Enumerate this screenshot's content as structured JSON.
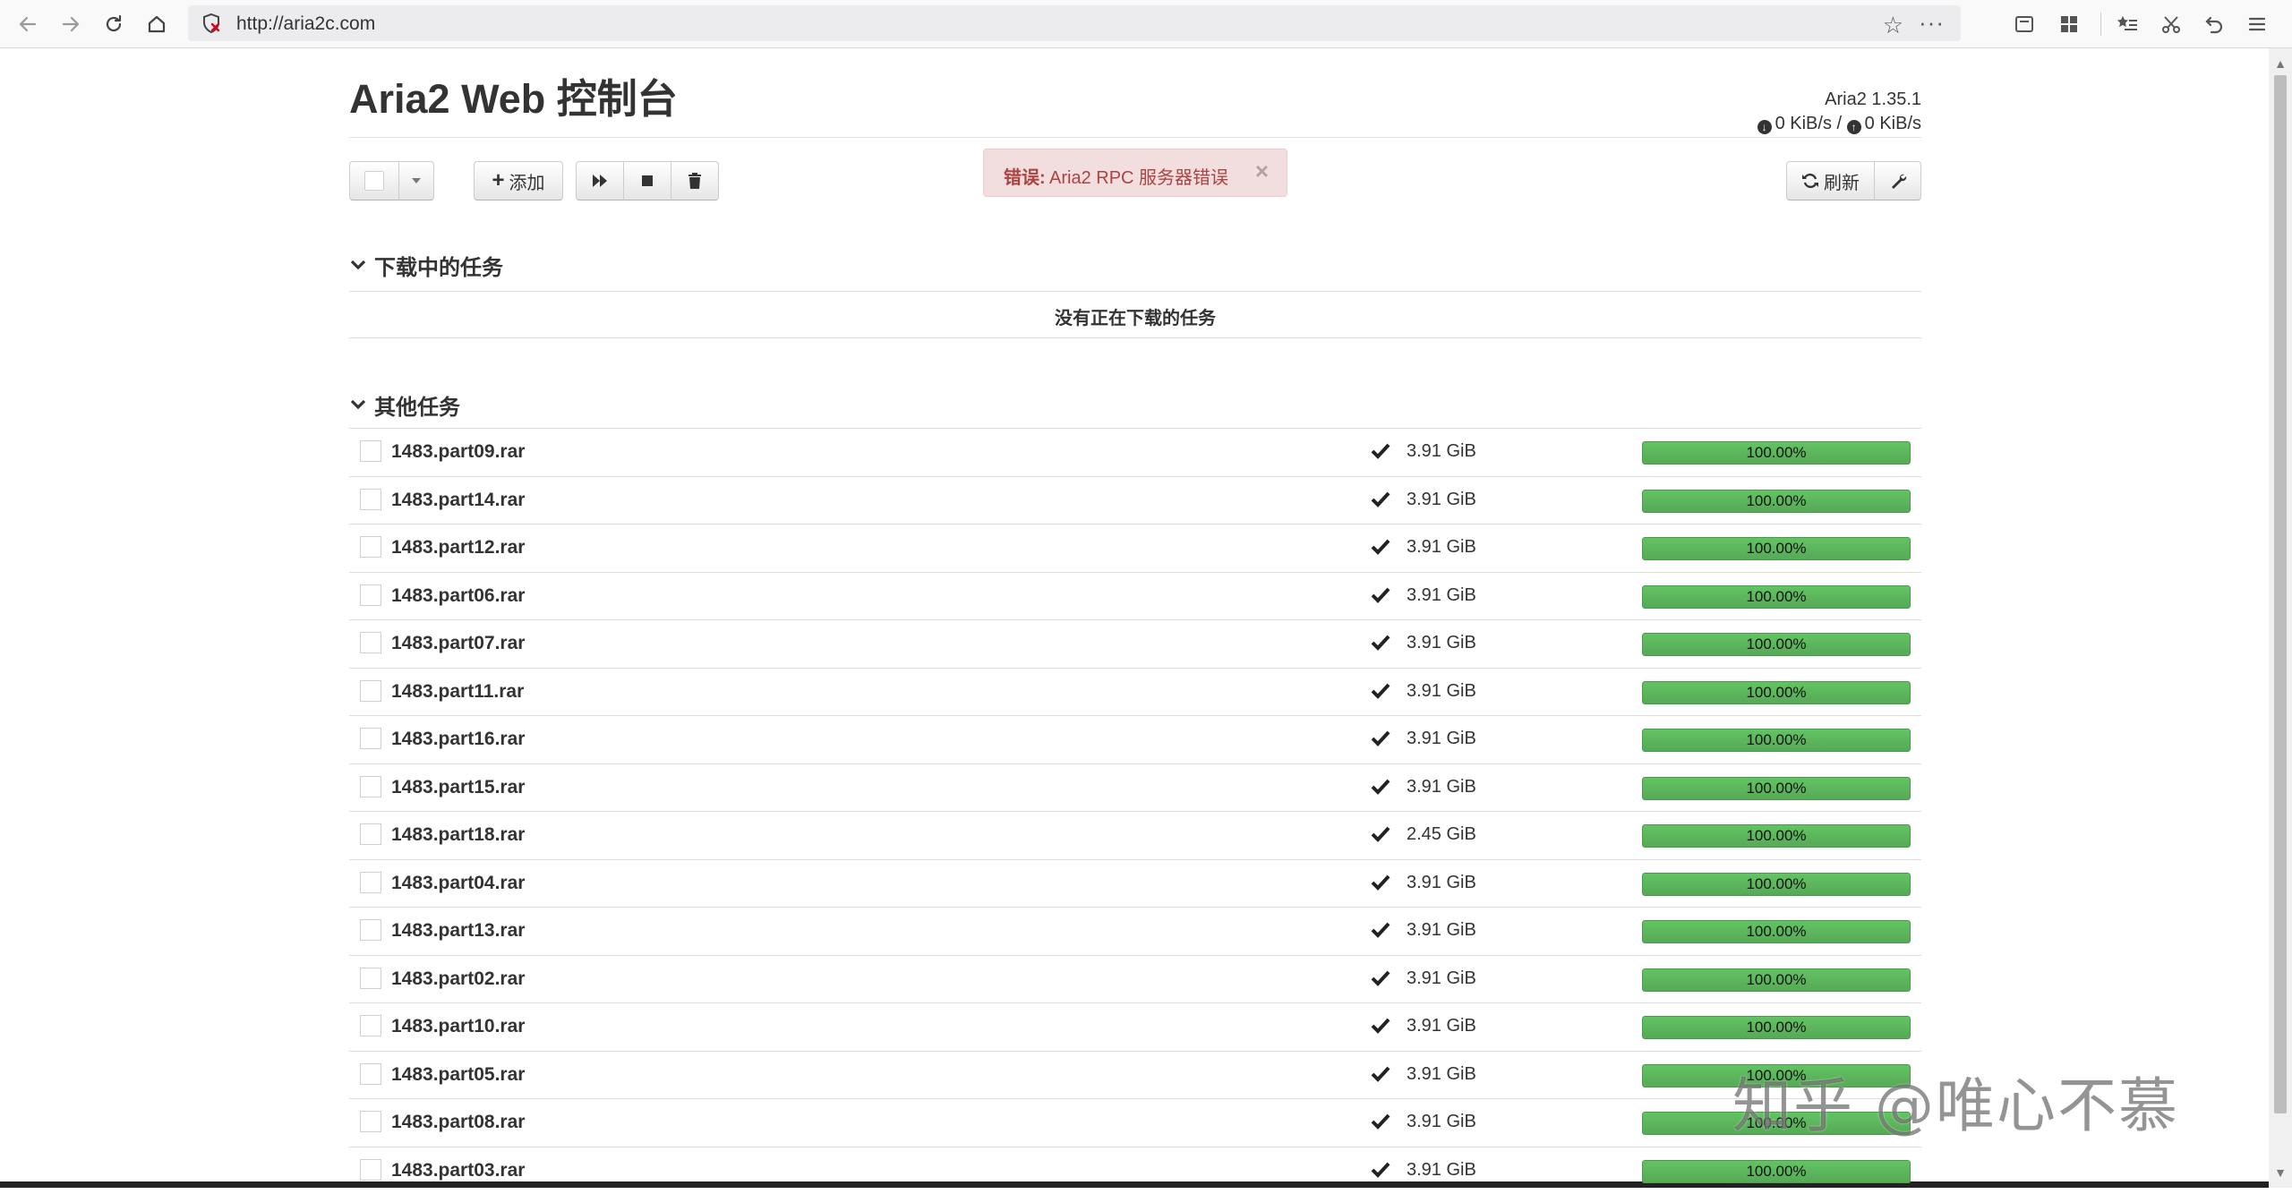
{
  "browser": {
    "url": "http://aria2c.com"
  },
  "header": {
    "title": "Aria2 Web 控制台",
    "version": "Aria2 1.35.1",
    "download_speed": "0 KiB/s",
    "speed_separator": "/",
    "upload_speed": "0 KiB/s"
  },
  "toolbar": {
    "add_label": "添加",
    "refresh_label": "刷新"
  },
  "alert": {
    "strong": "错误:",
    "message": "Aria2 RPC 服务器错误",
    "close": "×"
  },
  "sections": {
    "downloading": {
      "title": "下载中的任务",
      "empty_message": "没有正在下载的任务"
    },
    "others": {
      "title": "其他任务"
    }
  },
  "tasks": [
    {
      "name": "1483.part09.rar",
      "size": "3.91 GiB",
      "progress": "100.00%",
      "fraction": 1.0
    },
    {
      "name": "1483.part14.rar",
      "size": "3.91 GiB",
      "progress": "100.00%",
      "fraction": 1.0
    },
    {
      "name": "1483.part12.rar",
      "size": "3.91 GiB",
      "progress": "100.00%",
      "fraction": 1.0
    },
    {
      "name": "1483.part06.rar",
      "size": "3.91 GiB",
      "progress": "100.00%",
      "fraction": 1.0
    },
    {
      "name": "1483.part07.rar",
      "size": "3.91 GiB",
      "progress": "100.00%",
      "fraction": 1.0
    },
    {
      "name": "1483.part11.rar",
      "size": "3.91 GiB",
      "progress": "100.00%",
      "fraction": 1.0
    },
    {
      "name": "1483.part16.rar",
      "size": "3.91 GiB",
      "progress": "100.00%",
      "fraction": 1.0
    },
    {
      "name": "1483.part15.rar",
      "size": "3.91 GiB",
      "progress": "100.00%",
      "fraction": 1.0
    },
    {
      "name": "1483.part18.rar",
      "size": "2.45 GiB",
      "progress": "100.00%",
      "fraction": 1.0
    },
    {
      "name": "1483.part04.rar",
      "size": "3.91 GiB",
      "progress": "100.00%",
      "fraction": 1.0
    },
    {
      "name": "1483.part13.rar",
      "size": "3.91 GiB",
      "progress": "100.00%",
      "fraction": 1.0
    },
    {
      "name": "1483.part02.rar",
      "size": "3.91 GiB",
      "progress": "100.00%",
      "fraction": 1.0
    },
    {
      "name": "1483.part10.rar",
      "size": "3.91 GiB",
      "progress": "100.00%",
      "fraction": 1.0
    },
    {
      "name": "1483.part05.rar",
      "size": "3.91 GiB",
      "progress": "100.00%",
      "fraction": 1.0
    },
    {
      "name": "1483.part08.rar",
      "size": "3.91 GiB",
      "progress": "100.00%",
      "fraction": 1.0
    },
    {
      "name": "1483.part03.rar",
      "size": "3.91 GiB",
      "progress": "100.00%",
      "fraction": 1.0
    }
  ],
  "watermark": "知乎 @唯心不慕",
  "colors": {
    "progress_green": "#5cb85c",
    "alert_bg": "#f2dede",
    "alert_text": "#a94442"
  },
  "icons": [
    "back-arrow-icon",
    "forward-arrow-icon",
    "reload-icon",
    "home-icon",
    "shield-icon",
    "star-icon",
    "more-icon",
    "checkmark-icon",
    "play-icon",
    "stop-icon",
    "trash-icon",
    "wrench-icon",
    "refresh-icon",
    "chevron-down-icon"
  ]
}
